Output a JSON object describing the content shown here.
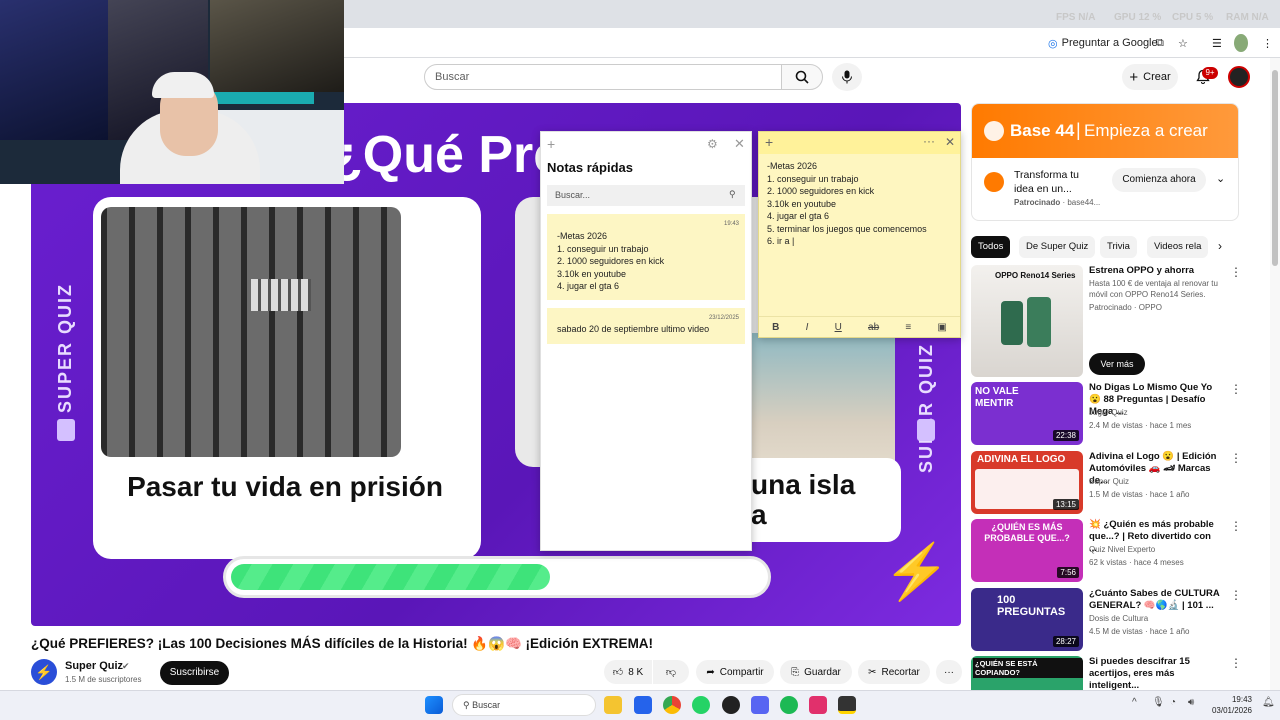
{
  "browser": {
    "hud": {
      "fps": "FPS N/A",
      "gpu": "GPU 12 %",
      "cpu": "CPU 5 %",
      "ram": "RAM N/A"
    },
    "ask_google": "Preguntar a Google"
  },
  "youtube": {
    "search_placeholder": "Buscar",
    "create_label": "Crear",
    "notif_count": "9+"
  },
  "video": {
    "overlay_title": "¿Qué Prefe",
    "side_text": "SUPER QUIZ",
    "option_left": "Pasar tu vida en prisión",
    "option_right_line1": "una isla",
    "option_right_line2": "a",
    "progress": 0.6
  },
  "notes_panel": {
    "title": "Notas rápidas",
    "search_placeholder": "Buscar...",
    "notes": [
      {
        "time": "19:43",
        "lines": [
          "-Metas 2026",
          "1. conseguir un trabajo",
          "2. 1000 seguidores en kick",
          "3.10k en youtube",
          "4. jugar el gta 6"
        ]
      },
      {
        "time": "23/12/2025",
        "lines": [
          "sabado 20 de septiembre ultimo video"
        ]
      }
    ]
  },
  "sticky": {
    "lines": [
      "-Metas 2026",
      "1. conseguir un trabajo",
      "2. 1000 seguidores en kick",
      "3.10k en youtube",
      "4. jugar el gta 6",
      "5. terminar los juegos que comencemos",
      "6. ir a |"
    ],
    "toolbar": [
      "B",
      "I",
      "U",
      "ab",
      "≡",
      "▣"
    ]
  },
  "meta": {
    "title": "¿Qué PREFIERES? ¡Las 100 Decisiones MÁS difíciles de la Historia! 🔥😱🧠 ¡Edición EXTREMA!",
    "channel": "Super Quiz",
    "subs": "1.5 M de suscriptores",
    "subscribe": "Suscribirse",
    "likes": "8 K",
    "share": "Compartir",
    "save": "Guardar",
    "clip": "Recortar"
  },
  "ad": {
    "brand": "Base 44",
    "tagline": "Empieza a crear",
    "text": "Transforma tu idea en un...",
    "cta": "Comienza ahora",
    "sponsored": "Patrocinado",
    "domain": "base44..."
  },
  "filters": [
    "Todos",
    "De Super Quiz",
    "Trivia",
    "Videos rela"
  ],
  "recs": [
    {
      "title": "Estrena OPPO y ahorra",
      "channel": "Hasta 100 € de ventaja al renovar tu móvil con OPPO Reno14 Series.",
      "stats": "Patrocinado · OPPO",
      "duration": "",
      "cta": "Ver más",
      "color": "#e9e6e2",
      "thumb_text": "OPPO Reno14 Series"
    },
    {
      "title": "No Digas Lo Mismo Que Yo 😮 88 Preguntas | Desafío Mega ...",
      "channel": "Jugar Quiz",
      "stats": "2.4 M de vistas · hace 1 mes",
      "duration": "22:38",
      "color": "#7b2fd0",
      "thumb_text": "NO VALE MENTIR"
    },
    {
      "title": "Adivina el Logo 😮 | Edición Automóviles 🚗 🏎 Marcas de...",
      "channel": "Super Quiz",
      "stats": "1.5 M de vistas · hace 1 año",
      "duration": "13:15",
      "color": "#d83a2a",
      "thumb_text": "ADIVINA EL LOGO"
    },
    {
      "title": "💥 ¿Quién es más probable que...? | Reto divertido con ...",
      "channel": "Quiz Nivel Experto",
      "stats": "62 k vistas · hace 4 meses",
      "duration": "7:56",
      "color": "#c42fb8",
      "thumb_text": "¿QUIÉN ES MÁS PROBABLE QUE...?"
    },
    {
      "title": "¿Cuánto Sabes de CULTURA GENERAL? 🧠🌎🔬 | 101 ...",
      "channel": "Dosis de Cultura",
      "stats": "4.5 M de vistas · hace 1 año",
      "duration": "28:27",
      "color": "#3a2a8a",
      "thumb_text": "100 PREGUNTAS"
    },
    {
      "title": "Si puedes descifrar 15 acertijos, eres más inteligent...",
      "channel": "",
      "stats": "",
      "duration": "",
      "color": "#2aa36a",
      "thumb_text": "¿QUIÉN SE ESTÁ COPIANDO?"
    }
  ],
  "taskbar": {
    "search": "Buscar",
    "time": "19:43",
    "date": "03/01/2026"
  }
}
